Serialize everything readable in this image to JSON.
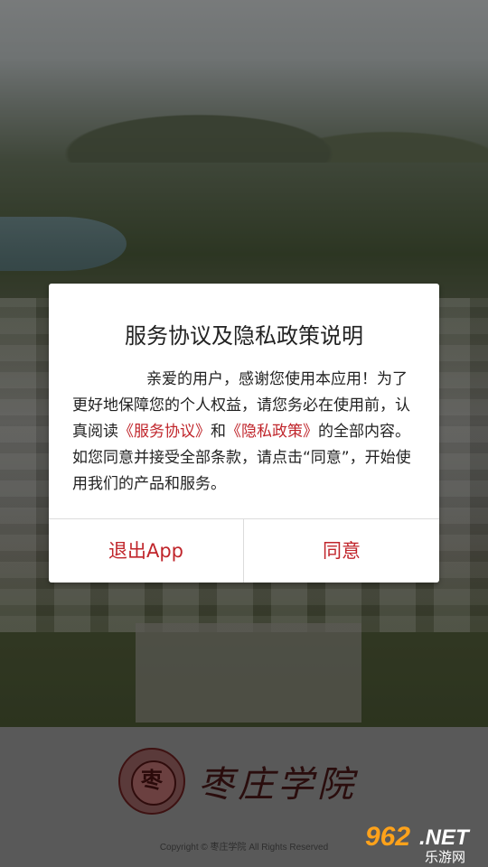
{
  "dialog": {
    "title": "服务协议及隐私政策说明",
    "body_part1": "亲爱的用户，感谢您使用本应用！为了更好地保障您的个人权益，请您务必在使用前，认真阅读",
    "service_link": "《服务协议》",
    "body_and": "和",
    "privacy_link": "《隐私政策》",
    "body_part2": "的全部内容。如您同意并接受全部条款，请点击“同意”，开始使用我们的产品和服务。",
    "exit_label": "退出App",
    "agree_label": "同意"
  },
  "brand": {
    "name": "枣庄学院",
    "seal_char": "枣",
    "copyright": "Copyright © 枣庄学院 All Rights Reserved"
  },
  "watermark": {
    "number": "962",
    "suffix": ".NET",
    "subtitle": "乐游网"
  },
  "colors": {
    "accent": "#c0252b",
    "dialog_bg": "#ffffff",
    "footer_bg": "#595959",
    "watermark_orange": "#ffa21a"
  }
}
